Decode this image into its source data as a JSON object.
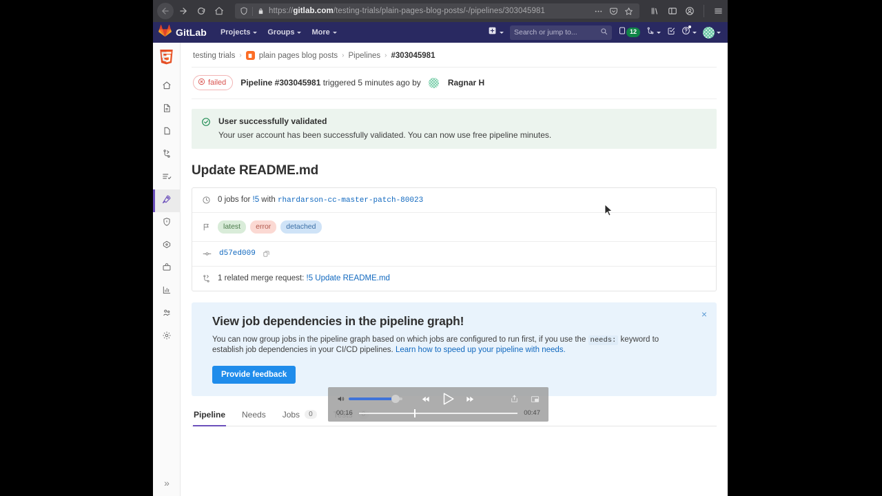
{
  "browser": {
    "url_prefix": "https://",
    "url_domain": "gitlab.com",
    "url_path": "/testing-trials/plain-pages-blog-posts/-/pipelines/303045981",
    "back_icon": "back-arrow-icon",
    "forward_icon": "forward-arrow-icon",
    "reload_icon": "reload-icon",
    "home_icon": "home-icon",
    "shield_icon": "shield-icon",
    "lock_icon": "lock-icon",
    "more_icon": "ellipsis-icon",
    "pocket_icon": "pocket-icon",
    "star_icon": "star-icon",
    "library_icon": "library-icon",
    "sidebar_icon": "sidebar-icon",
    "account_icon": "account-icon",
    "menu_icon": "hamburger-menu-icon"
  },
  "topnav": {
    "brand": "GitLab",
    "menu": [
      {
        "label": "Projects"
      },
      {
        "label": "Groups"
      },
      {
        "label": "More"
      }
    ],
    "search_placeholder": "Search or jump to...",
    "issues_count": "12",
    "plus_icon": "plus-square-icon",
    "issues_icon": "issues-icon",
    "merge_icon": "merge-request-icon",
    "todos_icon": "todos-icon",
    "help_icon": "help-circle-icon",
    "avatar_icon": "user-avatar"
  },
  "rail": {
    "logo": "html5-project-logo",
    "items": [
      {
        "name": "project-home",
        "icon": "home-icon",
        "active": false
      },
      {
        "name": "repository",
        "icon": "document-icon",
        "active": false
      },
      {
        "name": "issues",
        "icon": "issue-icon",
        "active": false
      },
      {
        "name": "merge-requests",
        "icon": "merge-request-icon",
        "active": false
      },
      {
        "name": "requirements",
        "icon": "list-check-icon",
        "active": false
      },
      {
        "name": "ci-cd",
        "icon": "rocket-icon",
        "active": true
      },
      {
        "name": "security-compliance",
        "icon": "shield-icon",
        "active": false
      },
      {
        "name": "deployments",
        "icon": "deploy-cloud-icon",
        "active": false
      },
      {
        "name": "packages-registries",
        "icon": "package-icon",
        "active": false
      },
      {
        "name": "analytics",
        "icon": "chart-bar-icon",
        "active": false
      },
      {
        "name": "members",
        "icon": "users-icon",
        "active": false
      },
      {
        "name": "settings",
        "icon": "gear-icon",
        "active": false
      }
    ],
    "collapse_label": "»"
  },
  "breadcrumb": {
    "group": "testing trials",
    "project": "plain pages blog posts",
    "section": "Pipelines",
    "current": "#303045981",
    "separator": "›"
  },
  "pipeline_header": {
    "status": "failed",
    "status_icon": "failed-status-icon",
    "title_bold": "Pipeline #303045981",
    "title_rest": " triggered 5 minutes ago by",
    "user": "Ragnar H"
  },
  "alert": {
    "icon": "check-circle-icon",
    "title": "User successfully validated",
    "text": "Your user account has been successfully validated. You can now use free pipeline minutes."
  },
  "page_title": "Update README.md",
  "info_card": {
    "jobs_row": {
      "icon": "clock-icon",
      "prefix": "0 jobs for ",
      "mr_link": "!5",
      "middle": " with ",
      "branch": "rhardarson-cc-master-patch-80023"
    },
    "tags_row": {
      "icon": "flag-icon",
      "badges": [
        {
          "label": "latest",
          "color": "green"
        },
        {
          "label": "error",
          "color": "red"
        },
        {
          "label": "detached",
          "color": "blue"
        }
      ]
    },
    "commit_row": {
      "icon": "commit-icon",
      "sha": "d57ed009",
      "copy_icon": "copy-icon"
    },
    "mr_row": {
      "icon": "merge-request-icon",
      "prefix": "1 related merge request: ",
      "link": "!5 Update README.md"
    }
  },
  "promo": {
    "title": "View job dependencies in the pipeline graph!",
    "body_1": "You can now group jobs in the pipeline graph based on which jobs are configured to run first, if you use the ",
    "code": "needs:",
    "body_2": " keyword to establish job dependencies in your CI/CD pipelines. ",
    "link": "Learn how to speed up your pipeline with needs.",
    "button": "Provide feedback",
    "close_icon": "close-icon",
    "close_label": "×"
  },
  "tabs": [
    {
      "label": "Pipeline",
      "count": null,
      "active": true
    },
    {
      "label": "Needs",
      "count": null,
      "active": false
    },
    {
      "label": "Jobs",
      "count": "0",
      "active": false
    },
    {
      "label": "Tests",
      "count": "0",
      "active": false
    }
  ],
  "video_controls": {
    "volume_icon": "volume-icon",
    "rewind_icon": "rewind-icon",
    "play_icon": "play-icon",
    "forward_icon": "fast-forward-icon",
    "share_icon": "share-icon",
    "pip_icon": "picture-in-picture-icon",
    "current_time": "00:16",
    "total_time": "00:47"
  },
  "colors": {
    "gitlab_nav": "#292961",
    "accent_purple": "#6b4fbb",
    "link_blue": "#1068bf",
    "button_blue": "#1f8ceb",
    "failed_red": "#d9534f",
    "success_green": "#108548"
  }
}
